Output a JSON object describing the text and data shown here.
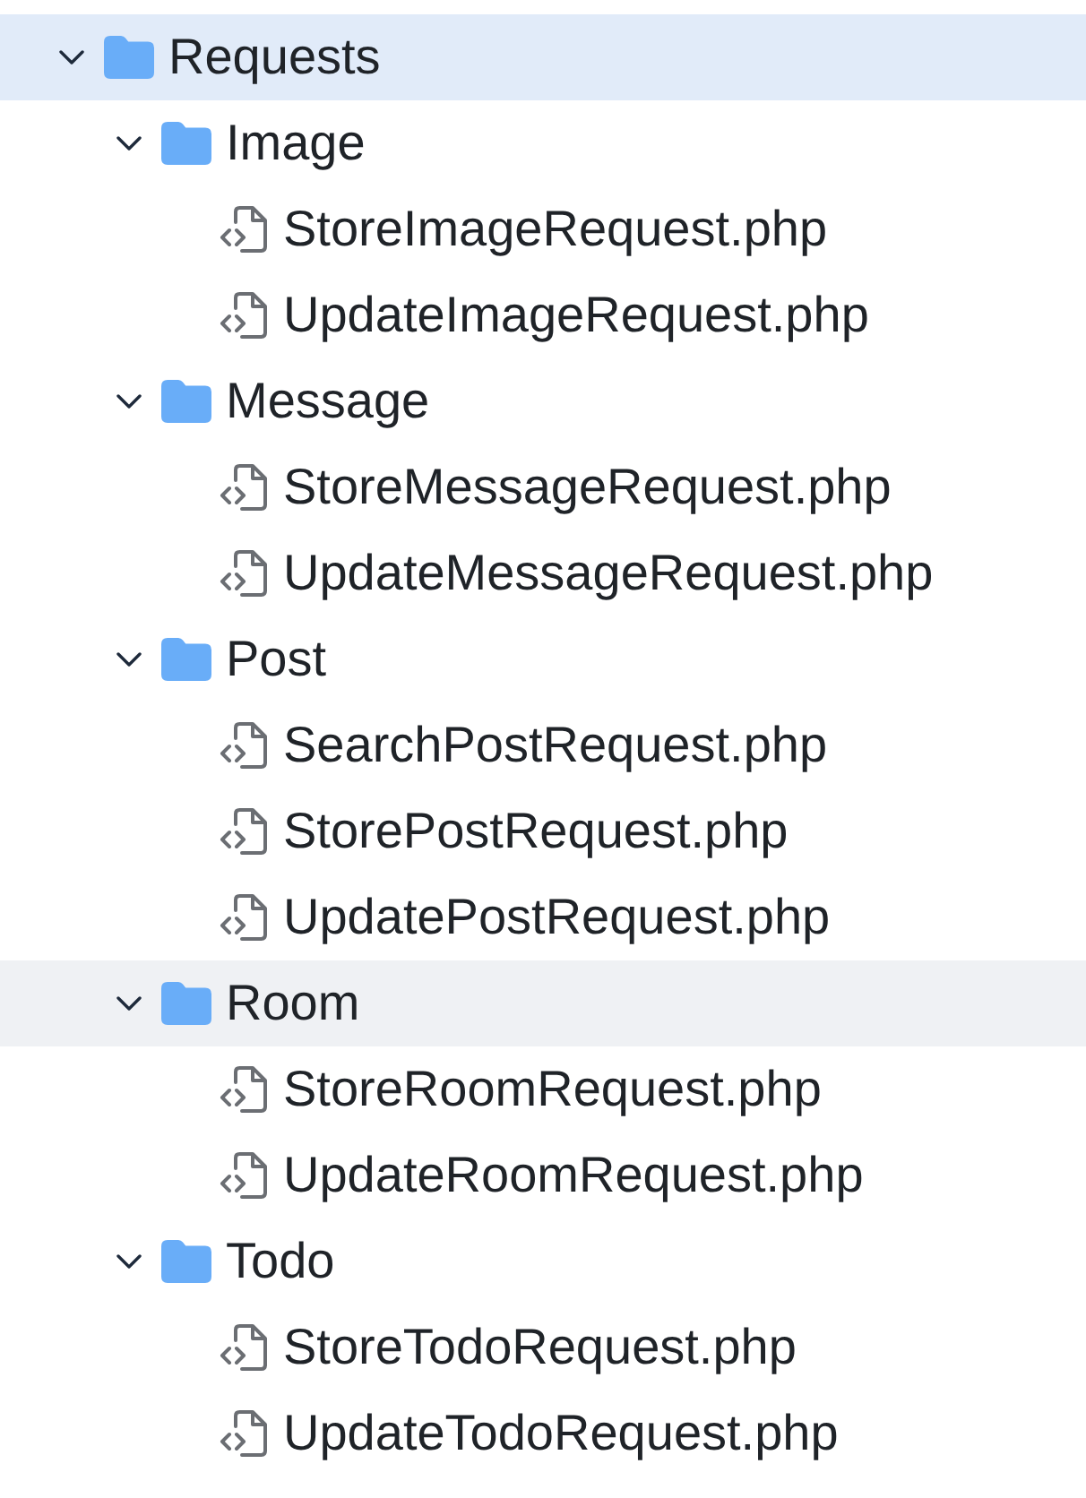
{
  "tree": [
    {
      "kind": "folder",
      "name": "Requests",
      "expanded": true,
      "selected": true,
      "hovered": false,
      "children": [
        {
          "kind": "folder",
          "name": "Image",
          "expanded": true,
          "selected": false,
          "hovered": false,
          "children": [
            {
              "kind": "file",
              "name": "StoreImageRequest.php",
              "selected": false,
              "hovered": false
            },
            {
              "kind": "file",
              "name": "UpdateImageRequest.php",
              "selected": false,
              "hovered": false
            }
          ]
        },
        {
          "kind": "folder",
          "name": "Message",
          "expanded": true,
          "selected": false,
          "hovered": false,
          "children": [
            {
              "kind": "file",
              "name": "StoreMessageRequest.php",
              "selected": false,
              "hovered": false
            },
            {
              "kind": "file",
              "name": "UpdateMessageRequest.php",
              "selected": false,
              "hovered": false
            }
          ]
        },
        {
          "kind": "folder",
          "name": "Post",
          "expanded": true,
          "selected": false,
          "hovered": false,
          "children": [
            {
              "kind": "file",
              "name": "SearchPostRequest.php",
              "selected": false,
              "hovered": false
            },
            {
              "kind": "file",
              "name": "StorePostRequest.php",
              "selected": false,
              "hovered": false
            },
            {
              "kind": "file",
              "name": "UpdatePostRequest.php",
              "selected": false,
              "hovered": false
            }
          ]
        },
        {
          "kind": "folder",
          "name": "Room",
          "expanded": true,
          "selected": false,
          "hovered": true,
          "children": [
            {
              "kind": "file",
              "name": "StoreRoomRequest.php",
              "selected": false,
              "hovered": false
            },
            {
              "kind": "file",
              "name": "UpdateRoomRequest.php",
              "selected": false,
              "hovered": false
            }
          ]
        },
        {
          "kind": "folder",
          "name": "Todo",
          "expanded": true,
          "selected": false,
          "hovered": false,
          "children": [
            {
              "kind": "file",
              "name": "StoreTodoRequest.php",
              "selected": false,
              "hovered": false
            },
            {
              "kind": "file",
              "name": "UpdateTodoRequest.php",
              "selected": false,
              "hovered": false
            }
          ]
        }
      ]
    }
  ]
}
